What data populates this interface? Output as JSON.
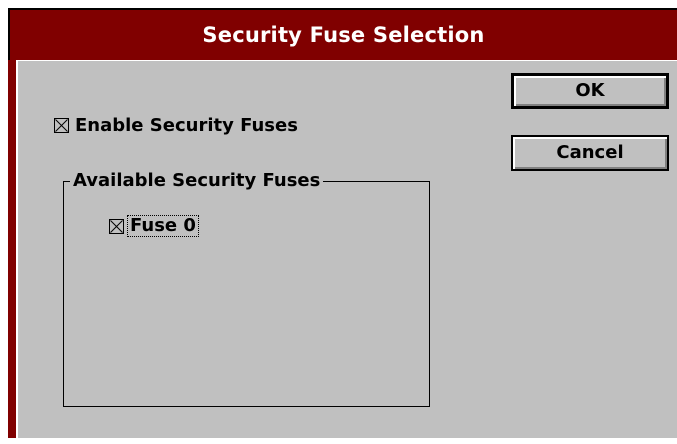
{
  "dialog": {
    "title": "Security Fuse Selection",
    "ok_label": "OK",
    "cancel_label": "Cancel",
    "enable_checkbox": {
      "label": "Enable Security Fuses",
      "checked": true
    },
    "group": {
      "title": "Available Security Fuses",
      "fuses": [
        {
          "label": "Fuse 0",
          "checked": true
        }
      ]
    }
  },
  "colors": {
    "titlebar": "#800000",
    "face": "#c0c0c0",
    "title_text": "#ffffff"
  }
}
